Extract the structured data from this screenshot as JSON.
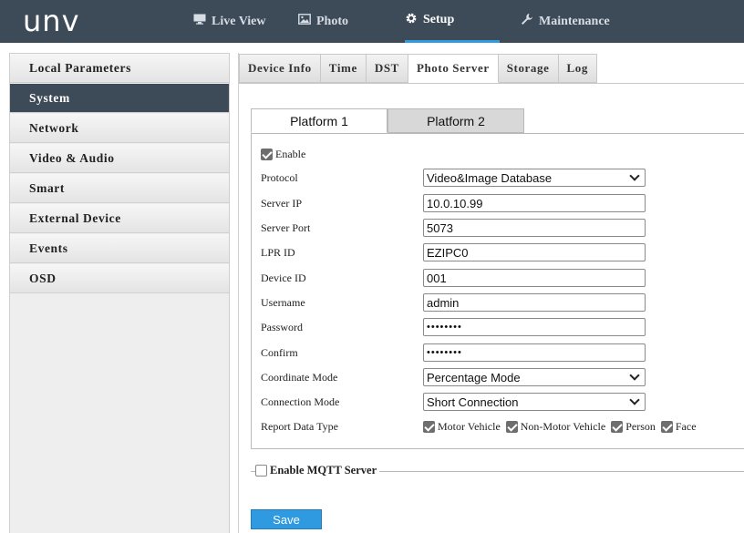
{
  "brand": {
    "logo": "UNV"
  },
  "top_nav": {
    "live_view": "Live View",
    "photo": "Photo",
    "setup": "Setup",
    "maintenance": "Maintenance"
  },
  "sidebar": {
    "items": [
      {
        "label": "Local Parameters"
      },
      {
        "label": "System"
      },
      {
        "label": "Network"
      },
      {
        "label": "Video & Audio"
      },
      {
        "label": "Smart"
      },
      {
        "label": "External Device"
      },
      {
        "label": "Events"
      },
      {
        "label": "OSD"
      }
    ],
    "active": "System"
  },
  "tabs": {
    "items": [
      {
        "label": "Device Info"
      },
      {
        "label": "Time"
      },
      {
        "label": "DST"
      },
      {
        "label": "Photo Server"
      },
      {
        "label": "Storage"
      },
      {
        "label": "Log"
      }
    ],
    "active": "Photo Server"
  },
  "platform_tabs": {
    "p1": "Platform 1",
    "p2": "Platform 2",
    "active": "Platform 1"
  },
  "form": {
    "enable": {
      "label": "Enable",
      "checked": true
    },
    "protocol": {
      "label": "Protocol",
      "value": "Video&Image Database"
    },
    "server_ip": {
      "label": "Server IP",
      "value": "10.0.10.99"
    },
    "server_port": {
      "label": "Server Port",
      "value": "5073"
    },
    "lpr_id": {
      "label": "LPR ID",
      "value": "EZIPC0"
    },
    "device_id": {
      "label": "Device ID",
      "value": "001"
    },
    "username": {
      "label": "Username",
      "value": "admin"
    },
    "password": {
      "label": "Password",
      "value": "••••••••"
    },
    "confirm": {
      "label": "Confirm",
      "value": "••••••••"
    },
    "coordinate_mode": {
      "label": "Coordinate Mode",
      "value": "Percentage Mode"
    },
    "connection_mode": {
      "label": "Connection Mode",
      "value": "Short Connection"
    },
    "report_data_type": {
      "label": "Report Data Type",
      "options": [
        {
          "label": "Motor Vehicle",
          "checked": true
        },
        {
          "label": "Non-Motor Vehicle",
          "checked": true
        },
        {
          "label": "Person",
          "checked": true
        },
        {
          "label": "Face",
          "checked": true
        }
      ]
    }
  },
  "mqtt": {
    "label": "Enable MQTT Server",
    "checked": false
  },
  "actions": {
    "save": "Save"
  },
  "colors": {
    "topbar": "#3d4a58",
    "accent": "#2f9ae0",
    "sidebar_active": "#3d4a58"
  }
}
